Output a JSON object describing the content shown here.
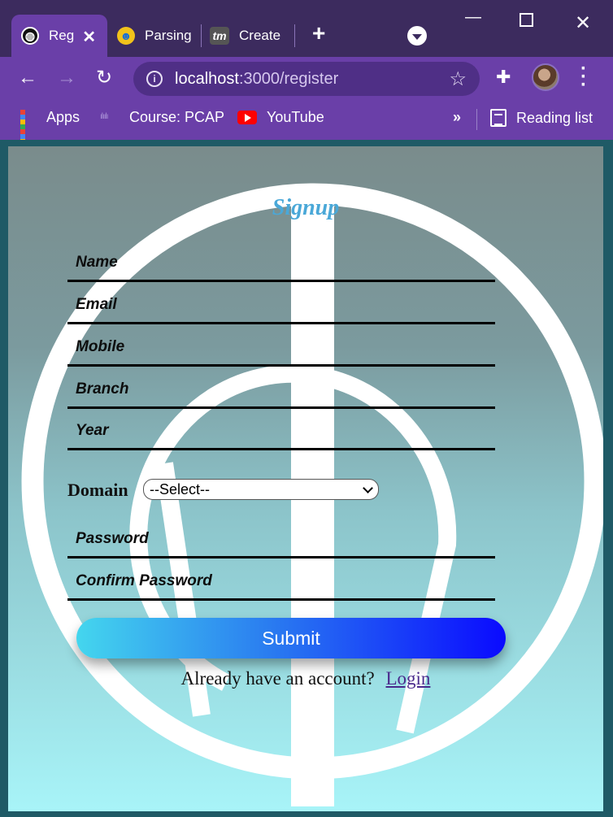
{
  "browser": {
    "tabs": [
      {
        "label": "Reg",
        "active": true,
        "icon": "web-icon"
      },
      {
        "label": "Parsing",
        "active": false,
        "icon": "emoji-icon"
      },
      {
        "label": "Create",
        "active": false,
        "icon": "tm-icon"
      }
    ],
    "tm_icon_text": "tm",
    "address": {
      "host": "localhost",
      "path": ":3000/register"
    },
    "bookmarks": [
      {
        "label": "Apps",
        "icon": "apps-grid-icon"
      },
      {
        "label": "Course: PCAP",
        "icon": "cisco-icon"
      },
      {
        "label": "YouTube",
        "icon": "youtube-icon"
      }
    ],
    "overflow": "»",
    "reading_list": "Reading list"
  },
  "form": {
    "title": "Signup",
    "fields": [
      {
        "placeholder": "Name"
      },
      {
        "placeholder": "Email"
      },
      {
        "placeholder": "Mobile"
      },
      {
        "placeholder": "Branch"
      },
      {
        "placeholder": "Year"
      },
      {
        "placeholder": "Password"
      },
      {
        "placeholder": "Confirm Password"
      }
    ],
    "domain_label": "Domain",
    "domain_selected": "--Select--",
    "submit_label": "Submit",
    "login_prompt": "Already have an account?",
    "login_link": "Login"
  },
  "colors": {
    "title": "#4aa8d8",
    "submit_start": "#44d6ee",
    "submit_end": "#0a0aff",
    "browser_frame": "#6a3fa8"
  }
}
